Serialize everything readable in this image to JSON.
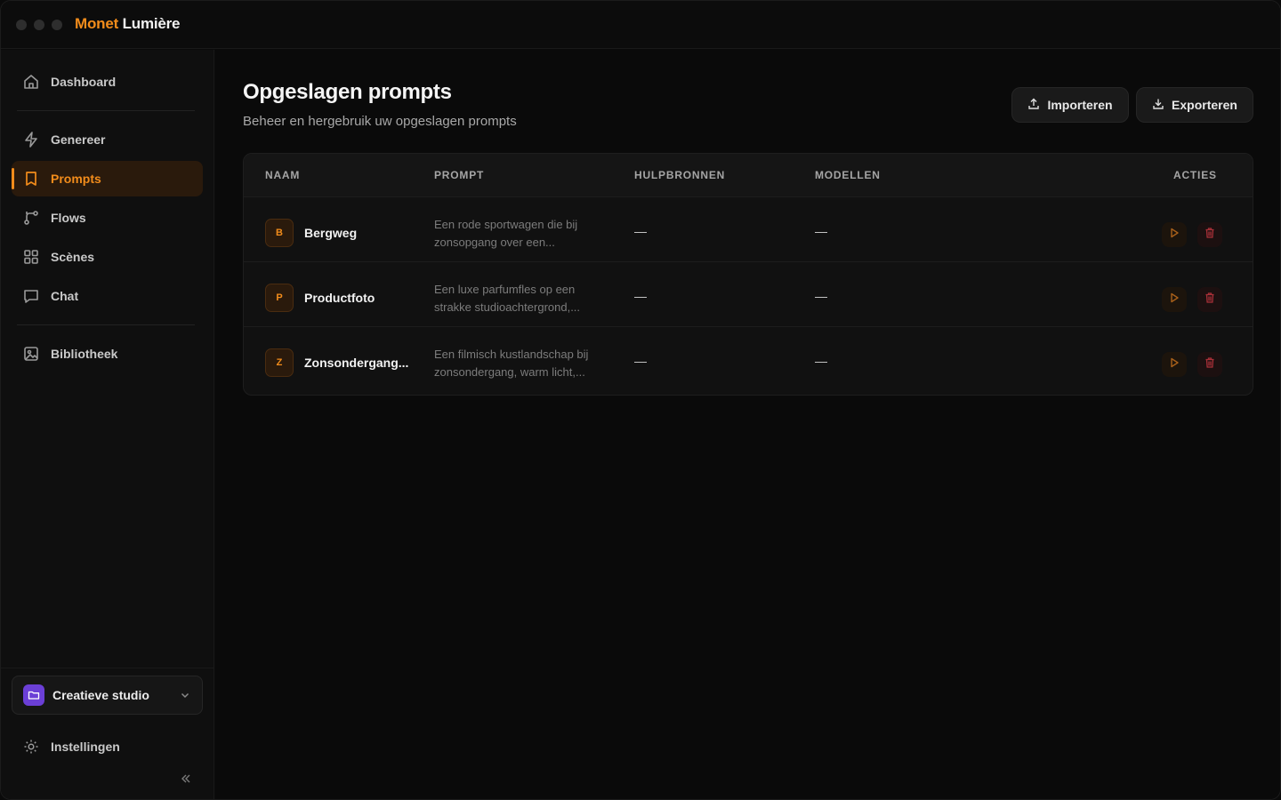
{
  "app": {
    "brand_part1": "Monet",
    "brand_part2": "Lumière"
  },
  "colors": {
    "accent": "#f28c1b",
    "workspace": "#6b3fd6",
    "delete": "#b8323a"
  },
  "sidebar": {
    "items": [
      {
        "label": "Dashboard",
        "icon": "home-icon"
      },
      {
        "label": "Genereer",
        "icon": "bolt-icon"
      },
      {
        "label": "Prompts",
        "icon": "bookmark-icon",
        "active": true
      },
      {
        "label": "Flows",
        "icon": "flow-icon"
      },
      {
        "label": "Scènes",
        "icon": "grid-icon"
      },
      {
        "label": "Chat",
        "icon": "chat-icon"
      },
      {
        "label": "Bibliotheek",
        "icon": "image-icon"
      }
    ],
    "workspace": {
      "label": "Creatieve studio",
      "icon": "folder-icon"
    },
    "settings_label": "Instellingen"
  },
  "page": {
    "title": "Opgeslagen prompts",
    "subtitle": "Beheer en hergebruik uw opgeslagen prompts",
    "import_label": "Importeren",
    "export_label": "Exporteren"
  },
  "table": {
    "columns": [
      "NAAM",
      "PROMPT",
      "HULPBRONNEN",
      "MODELLEN",
      "ACTIES"
    ],
    "rows": [
      {
        "initial": "B",
        "name": "Bergweg",
        "prompt": "Een rode sportwagen die bij zonsopgang over een...",
        "resources": "—",
        "models": "—"
      },
      {
        "initial": "P",
        "name": "Productfoto",
        "prompt": "Een luxe parfumfles op een strakke studioachtergrond,...",
        "resources": "—",
        "models": "—"
      },
      {
        "initial": "Z",
        "name": "Zonsondergang...",
        "prompt": "Een filmisch kustlandschap bij zonsondergang, warm licht,...",
        "resources": "—",
        "models": "—"
      }
    ]
  }
}
